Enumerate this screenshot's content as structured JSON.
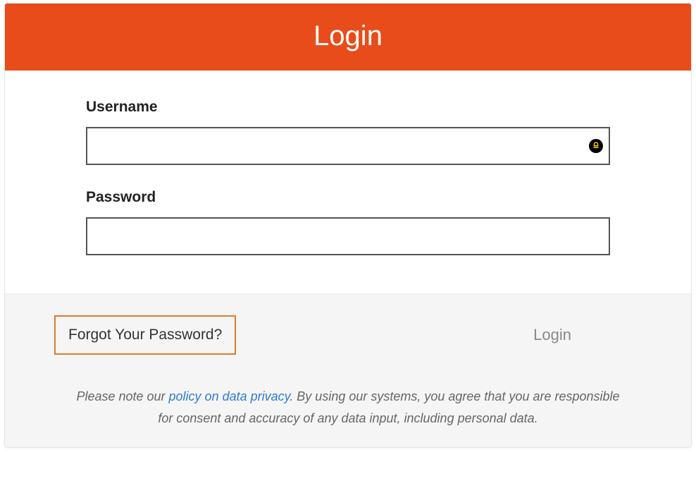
{
  "header": {
    "title": "Login"
  },
  "form": {
    "username": {
      "label": "Username",
      "value": ""
    },
    "password": {
      "label": "Password",
      "value": ""
    }
  },
  "actions": {
    "forgot_label": "Forgot Your Password?",
    "login_label": "Login"
  },
  "notice": {
    "prefix": "Please note our ",
    "link_text": "policy on data privacy",
    "suffix": ". By using our systems, you agree that you are responsible for consent and accuracy of any data input, including personal data."
  },
  "colors": {
    "accent": "#e84c1a",
    "highlight_border": "#e07b2e",
    "link": "#2e7bd6"
  }
}
